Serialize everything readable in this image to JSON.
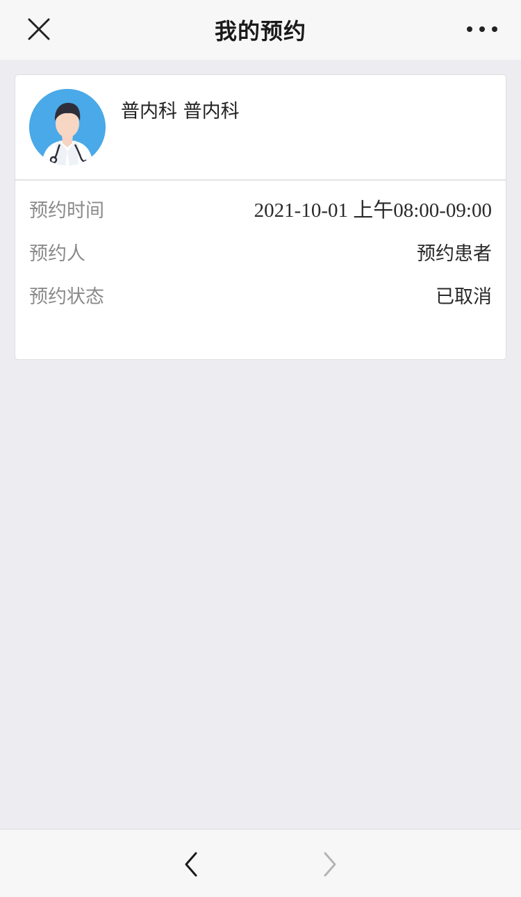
{
  "header": {
    "title": "我的预约",
    "close_icon": "close-icon",
    "more_icon": "more-dots-icon"
  },
  "appointment": {
    "avatar_icon": "doctor-avatar-icon",
    "department": "普内科 普内科",
    "rows": [
      {
        "label": "预约时间",
        "value": "2021-10-01 上午08:00-09:00"
      },
      {
        "label": "预约人",
        "value": "预约患者"
      },
      {
        "label": "预约状态",
        "value": "已取消"
      }
    ]
  },
  "bottom_nav": {
    "back_icon": "chevron-left-icon",
    "forward_icon": "chevron-right-icon"
  },
  "colors": {
    "background": "#ededf1",
    "header_bg": "#f7f7f7",
    "avatar_bg": "#4aa9e8",
    "label": "#8a8a8a",
    "value": "#2a2a2a"
  }
}
